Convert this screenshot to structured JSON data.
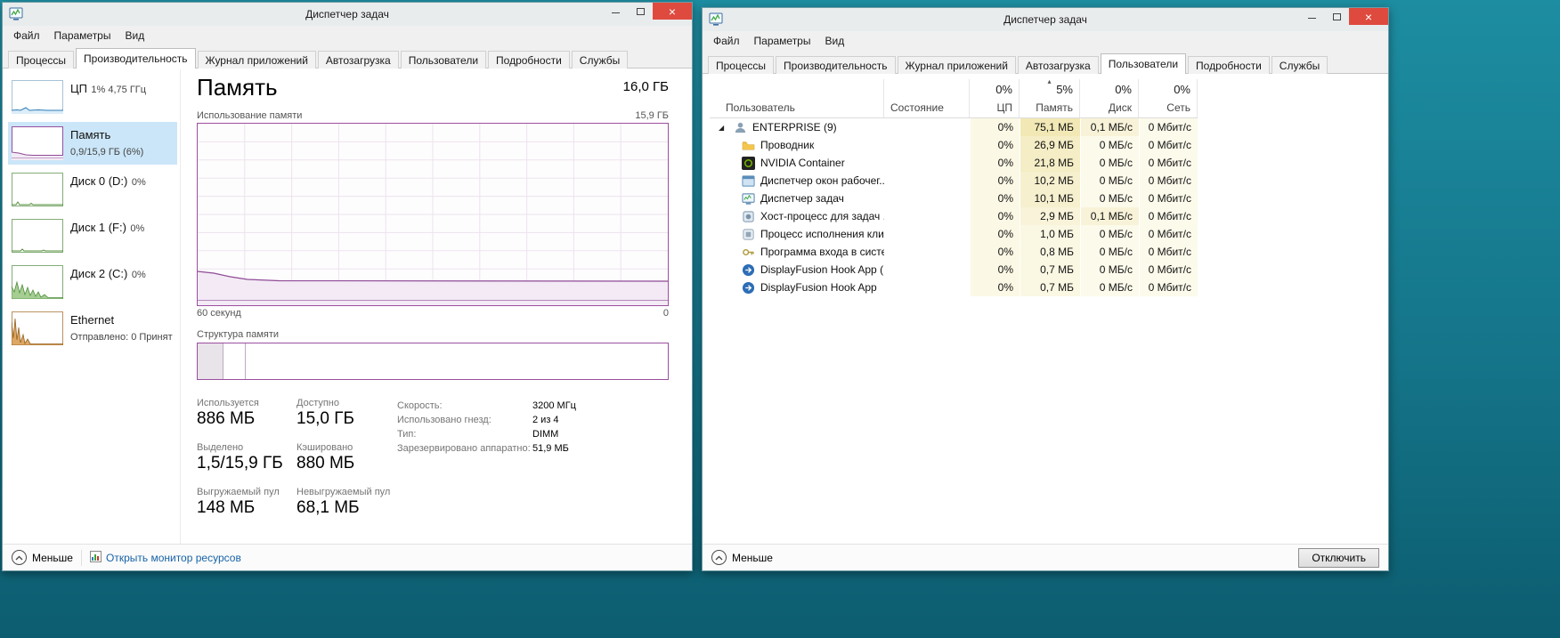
{
  "colors": {
    "desktop_teal": "#15758a",
    "close_red": "#df4a3e",
    "memory_purple": "#9b4f9e",
    "link_blue": "#1763a6",
    "selected_item_blue": "#cbe6f8",
    "heat_yellow": "#f1e8b5"
  },
  "icons": {
    "close": "×",
    "expand": "◢",
    "sort_asc": "▴"
  },
  "left_window": {
    "title": "Диспетчер задач",
    "menu": [
      "Файл",
      "Параметры",
      "Вид"
    ],
    "tabs": [
      "Процессы",
      "Производительность",
      "Журнал приложений",
      "Автозагрузка",
      "Пользователи",
      "Подробности",
      "Службы"
    ],
    "selected_tab": "Производительность",
    "sidebar": [
      {
        "name": "ЦП",
        "detail": "1% 4,75 ГГц"
      },
      {
        "name": "Память",
        "detail": "0,9/15,9 ГБ (6%)"
      },
      {
        "name": "Диск 0 (D:)",
        "detail": "0%"
      },
      {
        "name": "Диск 1 (F:)",
        "detail": "0%"
      },
      {
        "name": "Диск 2 (C:)",
        "detail": "0%"
      },
      {
        "name": "Ethernet",
        "detail": "Отправлено: 0 Принят"
      }
    ],
    "main": {
      "title": "Память",
      "total": "16,0 ГБ",
      "usage_label": "Использование памяти",
      "usage_max": "15,9 ГБ",
      "timeline_left": "60 секунд",
      "timeline_right": "0",
      "composition_label": "Структура памяти",
      "stats": {
        "in_use_label": "Используется",
        "in_use_value": "886 МБ",
        "available_label": "Доступно",
        "available_value": "15,0 ГБ",
        "committed_label": "Выделено",
        "committed_value": "1,5/15,9 ГБ",
        "cached_label": "Кэшировано",
        "cached_value": "880 МБ",
        "paged_label": "Выгружаемый пул",
        "paged_value": "148 МБ",
        "nonpaged_label": "Невыгружаемый пул",
        "nonpaged_value": "68,1 МБ"
      },
      "details": {
        "speed_label": "Скорость:",
        "speed_value": "3200 МГц",
        "slots_label": "Использовано гнезд:",
        "slots_value": "2 из 4",
        "type_label": "Тип:",
        "type_value": "DIMM",
        "reserved_label": "Зарезервировано аппаратно:",
        "reserved_value": "51,9 МБ"
      }
    },
    "footer": {
      "less": "Меньше",
      "resource_monitor": "Открыть монитор ресурсов"
    }
  },
  "right_window": {
    "title": "Диспетчер задач",
    "menu": [
      "Файл",
      "Параметры",
      "Вид"
    ],
    "tabs": [
      "Процессы",
      "Производительность",
      "Журнал приложений",
      "Автозагрузка",
      "Пользователи",
      "Подробности",
      "Службы"
    ],
    "selected_tab": "Пользователи",
    "header": {
      "user": "Пользователь",
      "status": "Состояние",
      "cpu_pct": "0%",
      "cpu_label": "ЦП",
      "mem_pct": "5%",
      "mem_label": "Память",
      "disk_pct": "0%",
      "disk_label": "Диск",
      "net_pct": "0%",
      "net_label": "Сеть"
    },
    "rows": [
      {
        "name": "ENTERPRISE (9)",
        "cpu": "0%",
        "mem": "75,1 МБ",
        "disk": "0,1 МБ/с",
        "net": "0 Мбит/с"
      },
      {
        "name": "Проводник",
        "cpu": "0%",
        "mem": "26,9 МБ",
        "disk": "0 МБ/с",
        "net": "0 Мбит/с"
      },
      {
        "name": "NVIDIA Container",
        "cpu": "0%",
        "mem": "21,8 МБ",
        "disk": "0 МБ/с",
        "net": "0 Мбит/с"
      },
      {
        "name": "Диспетчер окон рабочег...",
        "cpu": "0%",
        "mem": "10,2 МБ",
        "disk": "0 МБ/с",
        "net": "0 Мбит/с"
      },
      {
        "name": "Диспетчер задач",
        "cpu": "0%",
        "mem": "10,1 МБ",
        "disk": "0 МБ/с",
        "net": "0 Мбит/с"
      },
      {
        "name": "Хост-процесс для задач ...",
        "cpu": "0%",
        "mem": "2,9 МБ",
        "disk": "0,1 МБ/с",
        "net": "0 Мбит/с"
      },
      {
        "name": "Процесс исполнения кли...",
        "cpu": "0%",
        "mem": "1,0 МБ",
        "disk": "0 МБ/с",
        "net": "0 Мбит/с"
      },
      {
        "name": "Программа входа в систе...",
        "cpu": "0%",
        "mem": "0,8 МБ",
        "disk": "0 МБ/с",
        "net": "0 Мбит/с"
      },
      {
        "name": "DisplayFusion Hook App (...",
        "cpu": "0%",
        "mem": "0,7 МБ",
        "disk": "0 МБ/с",
        "net": "0 Мбит/с"
      },
      {
        "name": "DisplayFusion Hook App",
        "cpu": "0%",
        "mem": "0,7 МБ",
        "disk": "0 МБ/с",
        "net": "0 Мбит/с"
      }
    ],
    "footer": {
      "less": "Меньше",
      "disconnect": "Отключить"
    }
  }
}
